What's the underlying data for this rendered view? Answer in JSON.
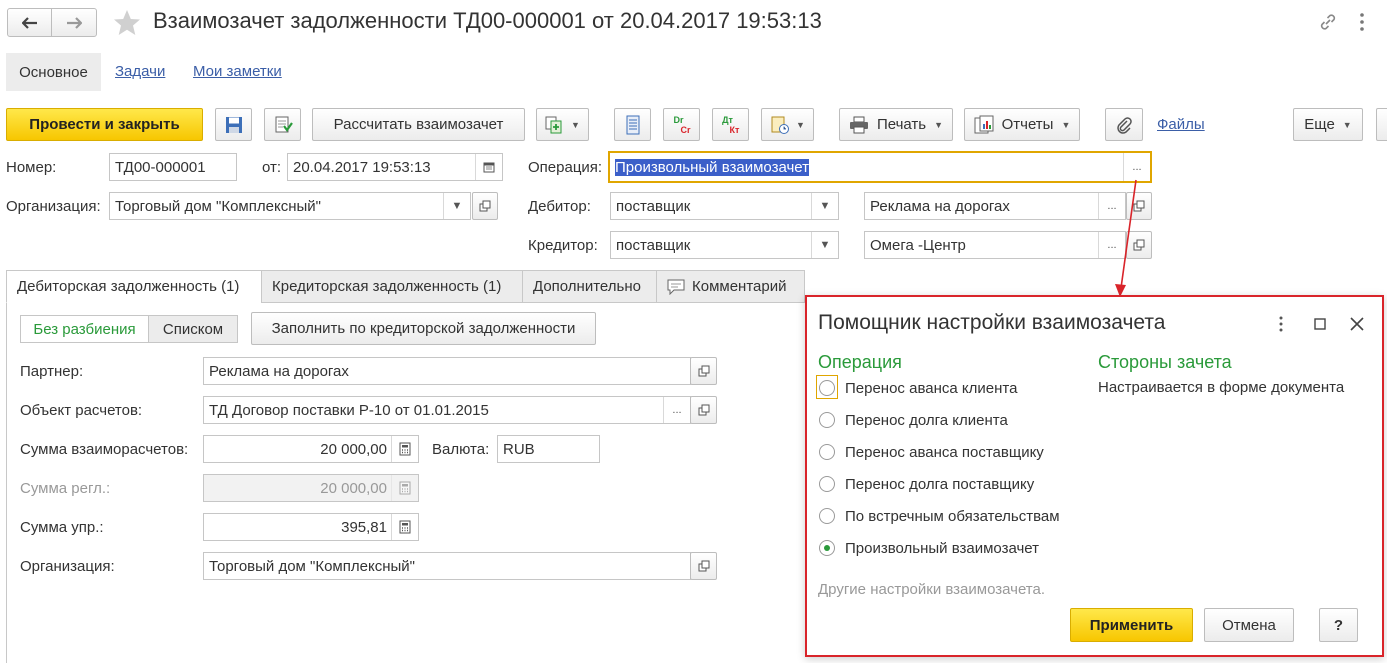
{
  "header": {
    "title": "Взаимозачет задолженности ТД00-000001 от 20.04.2017 19:53:13",
    "tabs": [
      "Основное",
      "Задачи",
      "Мои заметки"
    ]
  },
  "toolbar": {
    "post_close": "Провести и закрыть",
    "calculate": "Рассчитать взаимозачет",
    "dr_top": "Dr",
    "dr_bottom": "Cr",
    "dt_top": "Дт",
    "dt_bottom": "Кт",
    "print": "Печать",
    "reports": "Отчеты",
    "files": "Файлы",
    "more": "Еще"
  },
  "form": {
    "number_label": "Номер:",
    "number_value": "ТД00-000001",
    "from_label": "от:",
    "date_value": "20.04.2017 19:53:13",
    "operation_label": "Операция:",
    "operation_value": "Произвольный взаимозачет",
    "org_label": "Организация:",
    "org_value": "Торговый дом \"Комплексный\"",
    "debtor_label": "Дебитор:",
    "debtor_type": "поставщик",
    "debtor_value": "Реклама на дорогах",
    "creditor_label": "Кредитор:",
    "creditor_type": "поставщик",
    "creditor_value": "Омега -Центр",
    "ellipsis": "..."
  },
  "doc_tabs": [
    "Дебиторская задолженность (1)",
    "Кредиторская задолженность (1)",
    "Дополнительно",
    "Комментарий"
  ],
  "detail": {
    "mode_split": "Без разбиения",
    "mode_list": "Списком",
    "fill_button": "Заполнить по кредиторской задолженности",
    "partner_label": "Партнер:",
    "partner_value": "Реклама на дорогах",
    "object_label": "Объект расчетов:",
    "object_value": "ТД Договор поставки Р-10 от 01.01.2015",
    "sum_label": "Сумма взаиморасчетов:",
    "sum_value": "20 000,00",
    "currency_label": "Валюта:",
    "currency_value": "RUB",
    "reg_label": "Сумма регл.:",
    "reg_value": "20 000,00",
    "mgmt_label": "Сумма упр.:",
    "mgmt_value": "395,81",
    "org_label": "Организация:",
    "org_value": "Торговый дом \"Комплексный\""
  },
  "dialog": {
    "title": "Помощник настройки взаимозачета",
    "operation_header": "Операция",
    "sides_header": "Стороны зачета",
    "sides_text": "Настраивается в форме документа",
    "options": [
      "Перенос аванса клиента",
      "Перенос долга клиента",
      "Перенос аванса поставщику",
      "Перенос долга поставщику",
      "По встречным обязательствам",
      "Произвольный взаимозачет"
    ],
    "selected": "Произвольный взаимозачет",
    "other_settings": "Другие настройки взаимозачета.",
    "apply": "Применить",
    "cancel": "Отмена",
    "help": "?"
  },
  "colors": {
    "accent_yellow": "#f7c600",
    "highlight_border": "#e0a600",
    "dialog_border": "#d9242a",
    "green_header": "#2a9a3a",
    "selection": "#3b5fc9"
  }
}
